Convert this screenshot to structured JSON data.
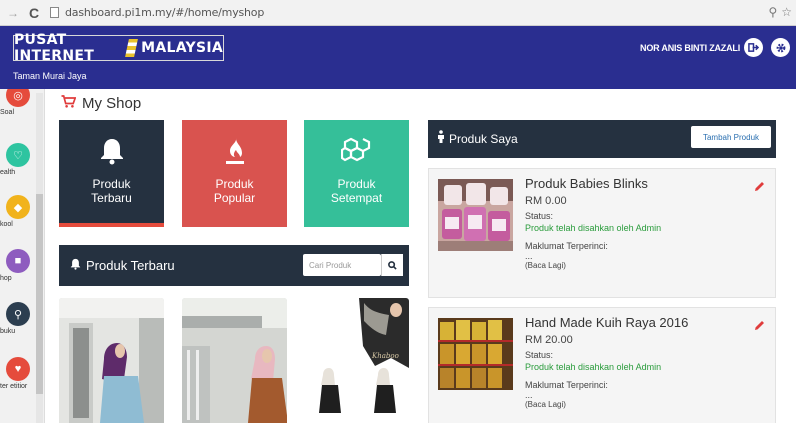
{
  "browser": {
    "url": "dashboard.pi1m.my/#/home/myshop"
  },
  "header": {
    "logo_left": "PUSAT INTERNET",
    "logo_right": "MALAYSIA",
    "location": "Taman Murai Jaya",
    "user_name": "NOR ANIS BINTI ZAZALI"
  },
  "sidebar": {
    "items": [
      {
        "label": "Soal",
        "color": "#e54b3c",
        "icon": "target-icon"
      },
      {
        "label": "ealth",
        "color": "#2ec4a0",
        "icon": "heart-icon"
      },
      {
        "label": "kool",
        "color": "#f1b31c",
        "icon": "school-icon"
      },
      {
        "label": "hop",
        "color": "#8e5cbf",
        "icon": "shop-icon"
      },
      {
        "label": "buku",
        "color": "#2c3e50",
        "icon": "book-icon"
      },
      {
        "label": "ter etitior",
        "color": "#e54b3c",
        "icon": "heart-icon"
      }
    ]
  },
  "page": {
    "title": "My Shop"
  },
  "tiles": [
    {
      "label_line1": "Produk",
      "label_line2": "Terbaru",
      "color": "#253140"
    },
    {
      "label_line1": "Produk",
      "label_line2": "Popular",
      "color": "#d9534f"
    },
    {
      "label_line1": "Produk",
      "label_line2": "Setempat",
      "color": "#35bf99"
    }
  ],
  "produk_terbaru": {
    "title": "Produk Terbaru",
    "search_placeholder": "Cari Produk"
  },
  "produk_saya": {
    "title": "Produk Saya",
    "add_button": "Tambah Produk",
    "items": [
      {
        "name": "Produk Babies Blinks",
        "price": "RM 0.00",
        "status_label": "Status:",
        "status": "Produk telah disahkan oleh Admin",
        "details_label": "Maklumat Terperinci:",
        "details": "...",
        "more": "(Baca Lagi)"
      },
      {
        "name": "Hand Made Kuih Raya 2016",
        "price": "RM 20.00",
        "status_label": "Status:",
        "status": "Produk telah disahkan oleh Admin",
        "details_label": "Maklumat Terperinci:",
        "details": "...",
        "more": "(Baca Lagi)"
      }
    ]
  },
  "colors": {
    "header": "#2a2e90",
    "dark_panel": "#253140",
    "edit": "#e03c3c",
    "status_ok": "#2a9c3c"
  }
}
